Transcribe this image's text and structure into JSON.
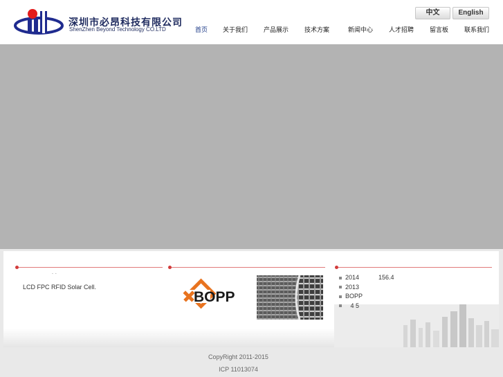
{
  "brand": {
    "name_cn": "深圳市必昂科技有限公司",
    "name_en": "ShenZhen Beyond Technology CO.LTD"
  },
  "language": {
    "chinese": "中文",
    "english": "English"
  },
  "nav": {
    "items": [
      {
        "label": "首页"
      },
      {
        "label": "关于我们"
      },
      {
        "label": "产品展示"
      },
      {
        "label": "技术方案"
      },
      {
        "label": "新闻中心"
      },
      {
        "label": "人才招聘"
      },
      {
        "label": "留言板"
      },
      {
        "label": "联系我们"
      }
    ],
    "active_index": 0
  },
  "about": {
    "marks": "˙   ˙",
    "text": "LCD FPC RFID Solar Cell."
  },
  "products": {
    "bopp_logo": "BOPP"
  },
  "news": {
    "items": [
      {
        "date": "2014",
        "value": "156.4"
      },
      {
        "date": "2013",
        "value": ""
      },
      {
        "date": "BOPP",
        "value": ""
      },
      {
        "date": "   4 5",
        "value": ""
      }
    ]
  },
  "footer": {
    "copyright": "CopyRight 2011-2015",
    "icp": "ICP 11013074"
  },
  "colors": {
    "nav_active": "#1f3c88",
    "accent_red": "#d23b3b",
    "banner_gray": "#b3b3b3"
  }
}
